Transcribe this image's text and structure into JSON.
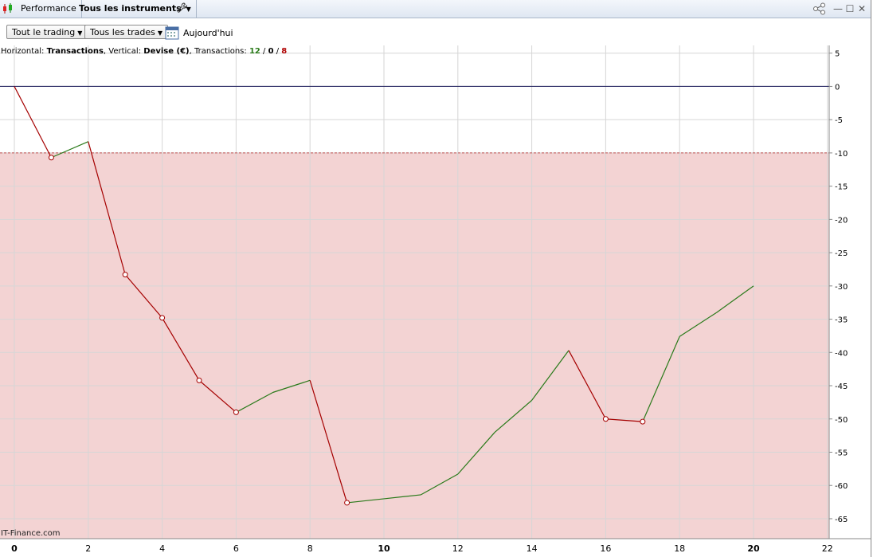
{
  "window": {
    "tab_performance": "Performance",
    "tab_instruments": "Tous les instruments",
    "minimize": "—",
    "maximize": "☐",
    "close": "✕"
  },
  "toolbar": {
    "trading_filter": "Tout le trading",
    "trades_filter": "Tous les trades",
    "date_label": "Aujourd'hui"
  },
  "caption": {
    "prefix": "Horizontal: ",
    "horizontal": "Transactions",
    "mid": ", Vertical: ",
    "vertical": "Devise (€)",
    "mid2": ", Transactions: ",
    "winning": "12",
    "sep1": " / ",
    "neutral": "0",
    "sep2": " / ",
    "losing": "8"
  },
  "watermark": "IT-Finance.com",
  "chart_data": {
    "type": "line",
    "x": [
      0,
      1,
      2,
      3,
      4,
      5,
      6,
      7,
      8,
      9,
      10,
      11,
      12,
      13,
      14,
      15,
      16,
      17,
      18,
      19,
      20
    ],
    "values": [
      0,
      -10.7,
      -8.3,
      -28.3,
      -34.8,
      -44.2,
      -49.0,
      -46.0,
      -44.2,
      -62.6,
      -62.0,
      -61.4,
      -58.3,
      -52.0,
      -47.2,
      -39.7,
      -50.0,
      -50.4,
      -37.6,
      -34.0,
      -30.0
    ],
    "segment_colors": {
      "up": "#2a7a1a",
      "down": "#a50000"
    },
    "zero_line_color": "#1a1a5a",
    "drawdown_threshold": -10,
    "drawdown_fill": "#f3d3d3",
    "xlim": [
      0,
      22
    ],
    "ylim": [
      -68,
      7
    ],
    "xticks": [
      0,
      2,
      4,
      6,
      8,
      10,
      12,
      14,
      16,
      18,
      20,
      22
    ],
    "xtick_bold": [
      0,
      10,
      20
    ],
    "yticks": [
      5,
      0,
      -5,
      -10,
      -15,
      -20,
      -25,
      -30,
      -35,
      -40,
      -45,
      -50,
      -55,
      -60,
      -65
    ],
    "grid": true
  }
}
